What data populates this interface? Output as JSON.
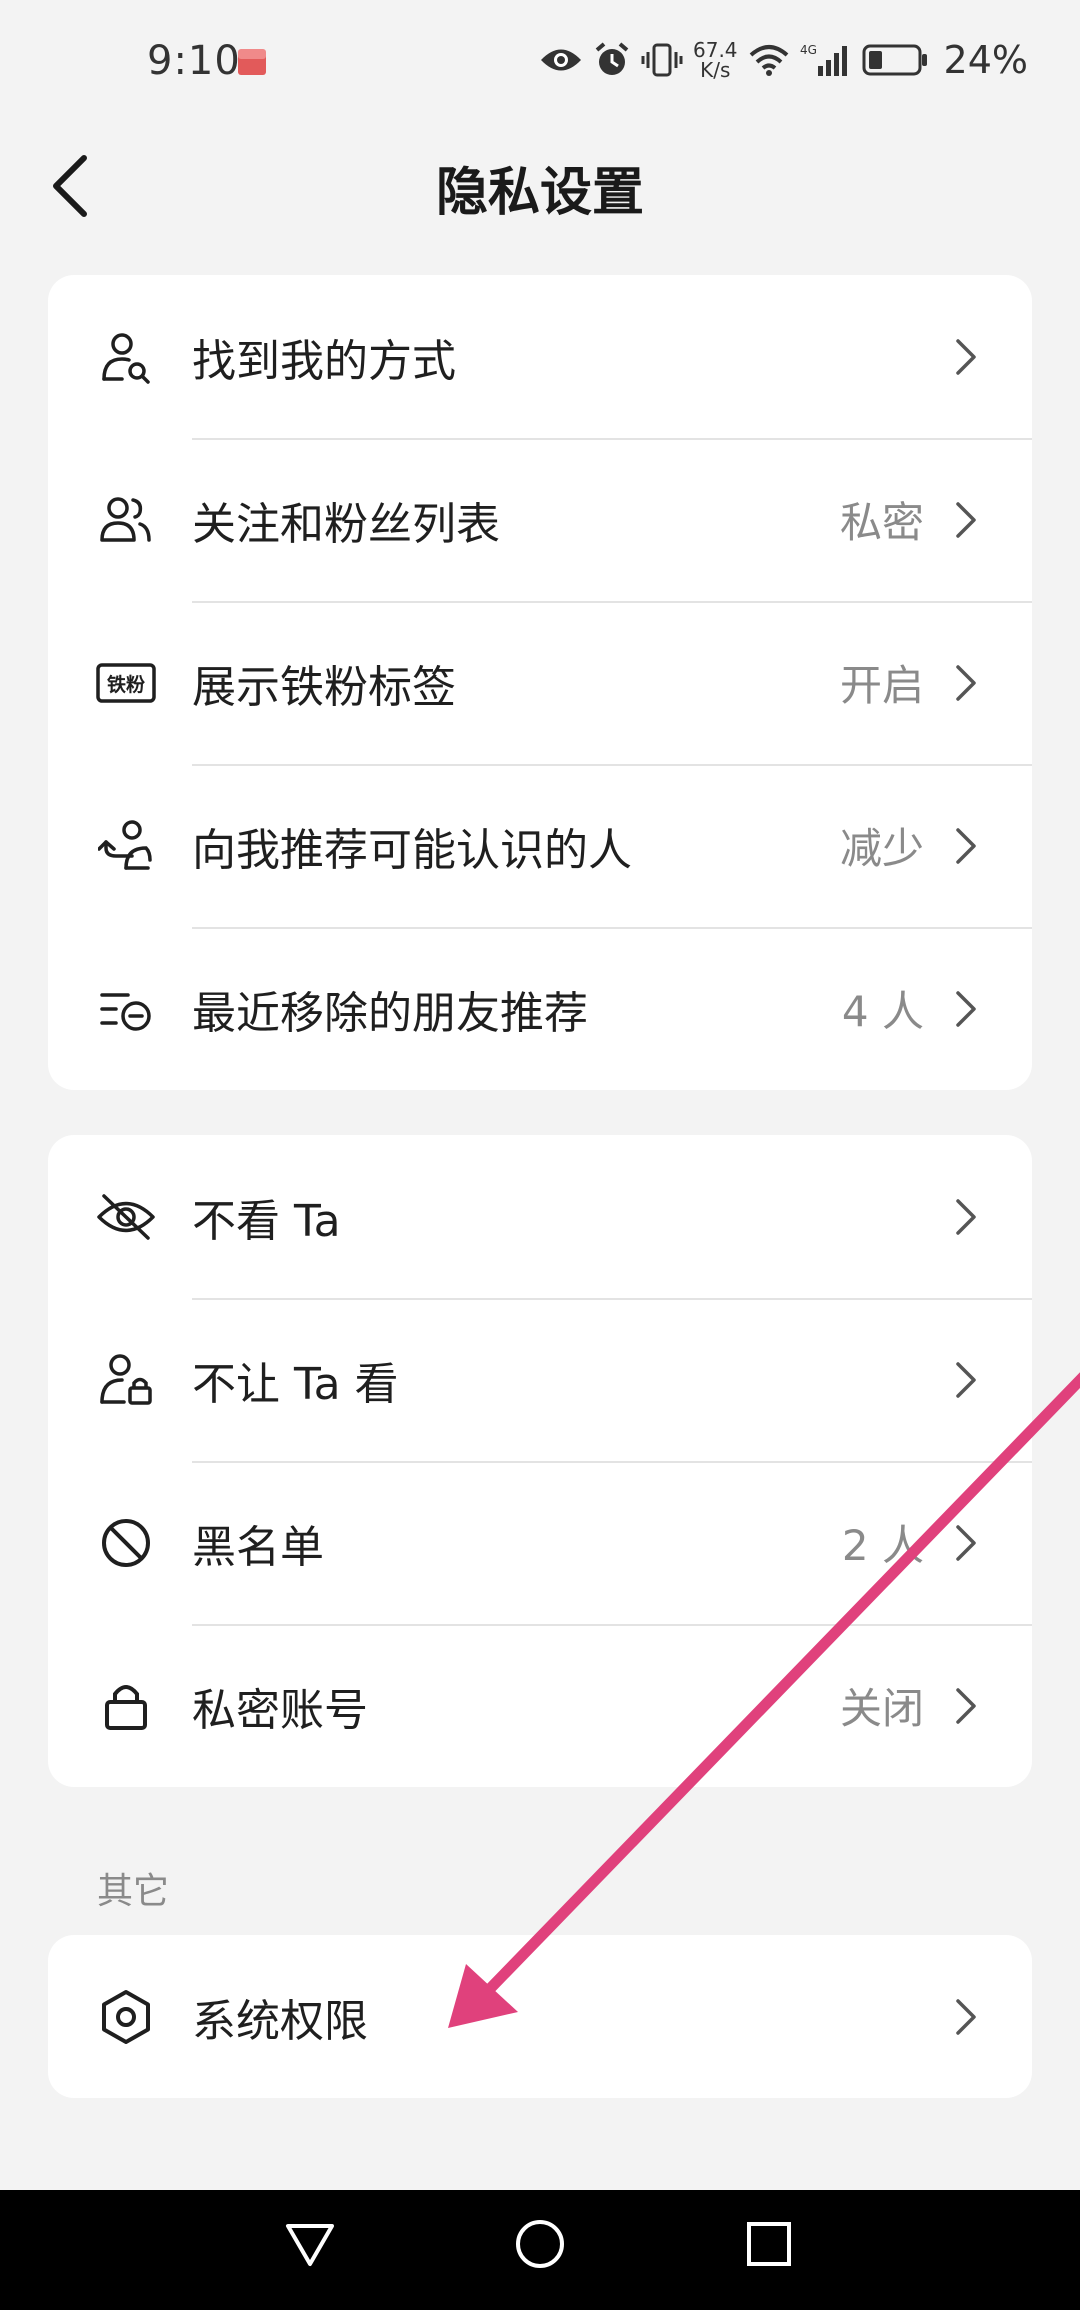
{
  "status_bar": {
    "time": "9:10",
    "net_speed_value": "67.4",
    "net_speed_unit": "K/s",
    "network_type": "4G",
    "battery": "24%"
  },
  "header": {
    "title": "隐私设置"
  },
  "group1": {
    "items": [
      {
        "label": "找到我的方式",
        "value": "",
        "icon": "find-person-icon"
      },
      {
        "label": "关注和粉丝列表",
        "value": "私密",
        "icon": "followers-icon"
      },
      {
        "label": "展示铁粉标签",
        "value": "开启",
        "icon": "fan-badge-icon",
        "badge_text": "铁粉"
      },
      {
        "label": "向我推荐可能认识的人",
        "value": "减少",
        "icon": "recommend-person-icon"
      },
      {
        "label": "最近移除的朋友推荐",
        "value": "4 人",
        "icon": "removed-list-icon"
      }
    ]
  },
  "group2": {
    "items": [
      {
        "label": "不看 Ta",
        "value": "",
        "icon": "eye-off-icon"
      },
      {
        "label": "不让 Ta 看",
        "value": "",
        "icon": "person-lock-icon"
      },
      {
        "label": "黑名单",
        "value": "2 人",
        "icon": "block-icon"
      },
      {
        "label": "私密账号",
        "value": "关闭",
        "icon": "lock-icon"
      }
    ]
  },
  "section_other": {
    "title": "其它",
    "items": [
      {
        "label": "系统权限",
        "value": "",
        "icon": "hexagon-settings-icon"
      }
    ]
  },
  "colors": {
    "background": "#f3f3f3",
    "card": "#ffffff",
    "annotation_arrow": "#e0417c"
  }
}
